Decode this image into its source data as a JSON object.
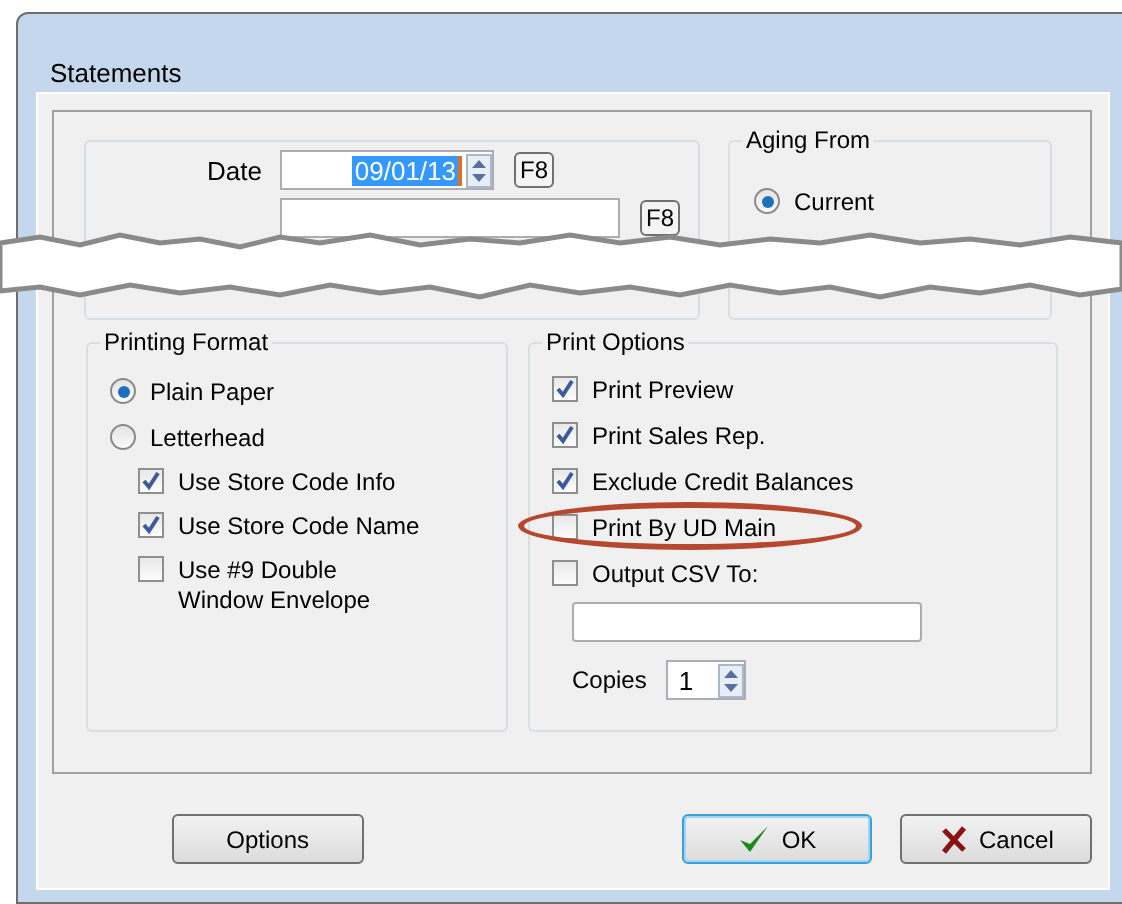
{
  "window": {
    "title": "Statements"
  },
  "date_group": {
    "date_label": "Date",
    "date_value": "09/01/13",
    "date_key": "F8",
    "name_key": "F8"
  },
  "aging_from": {
    "title": "Aging From",
    "options": [
      {
        "label": "Current",
        "selected": true
      }
    ]
  },
  "printing_format": {
    "title": "Printing Format",
    "radios": [
      {
        "label": "Plain Paper",
        "selected": true
      },
      {
        "label": "Letterhead",
        "selected": false
      }
    ],
    "checkboxes": [
      {
        "label": "Use Store Code Info",
        "checked": true
      },
      {
        "label": "Use Store Code Name",
        "checked": true
      },
      {
        "label": "Use #9 Double\nWindow Envelope",
        "checked": false
      }
    ]
  },
  "print_options": {
    "title": "Print Options",
    "checkboxes": [
      {
        "label": "Print Preview",
        "checked": true,
        "circled": false
      },
      {
        "label": "Print Sales Rep.",
        "checked": true,
        "circled": false
      },
      {
        "label": "Exclude Credit Balances",
        "checked": true,
        "circled": false
      },
      {
        "label": "Print By UD Main",
        "checked": false,
        "circled": true
      },
      {
        "label": "Output CSV To:",
        "checked": false,
        "circled": false
      }
    ],
    "copies_label": "Copies",
    "copies_value": "1"
  },
  "buttons": [
    {
      "label": "Options",
      "kind": "plain"
    },
    {
      "label": "OK",
      "kind": "ok"
    },
    {
      "label": "Cancel",
      "kind": "cancel"
    }
  ]
}
